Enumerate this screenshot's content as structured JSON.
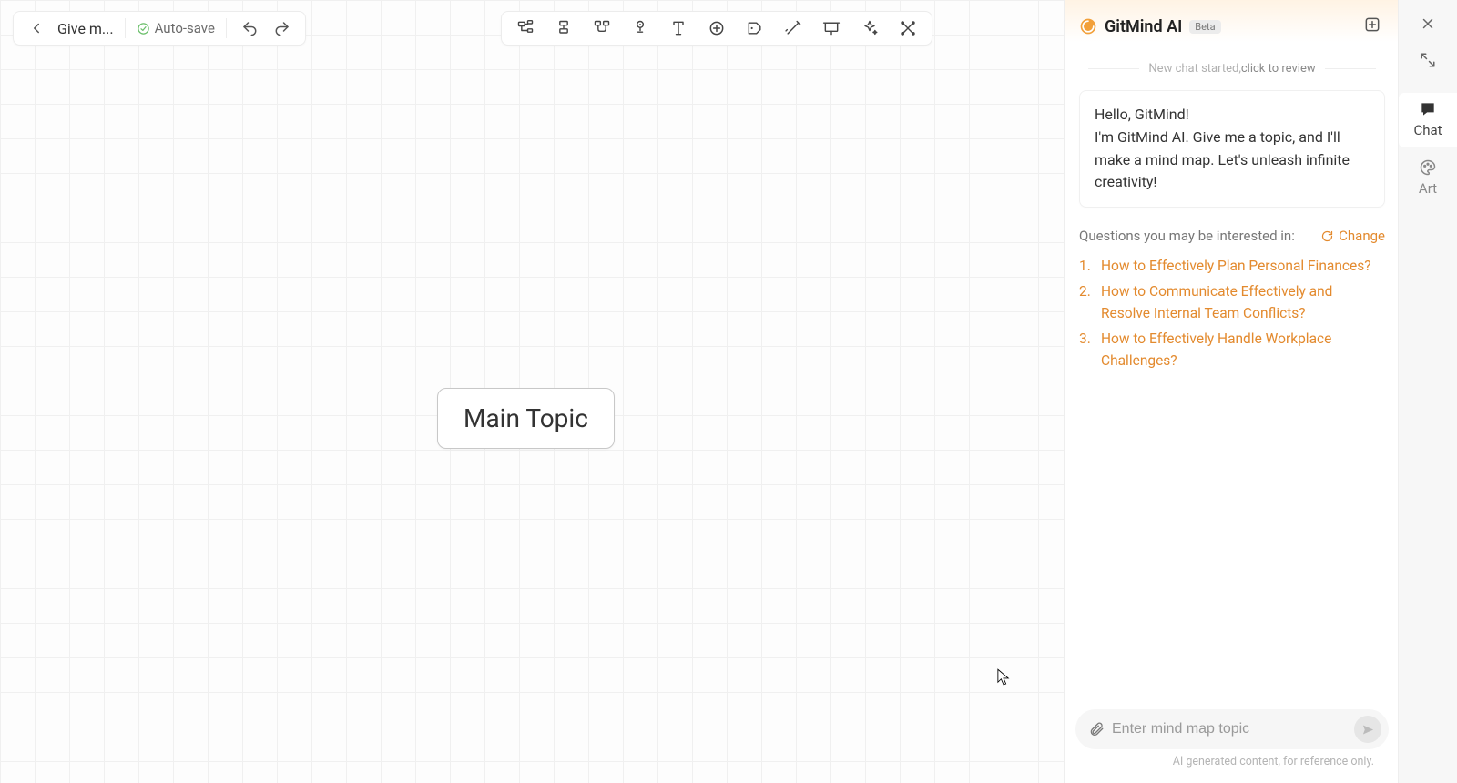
{
  "header": {
    "title": "Give m...",
    "auto_save": "Auto-save"
  },
  "canvas": {
    "main_topic": "Main Topic"
  },
  "ai": {
    "title": "GitMind AI",
    "badge": "Beta",
    "new_chat_prefix": "New chat started, ",
    "review_link": "click to review",
    "greeting": "Hello, GitMind!",
    "intro": "I'm GitMind AI. Give me a topic, and I'll make a mind map. Let's unleash infinite creativity!",
    "subhead": "Questions you may be interested in:",
    "change_label": "Change",
    "suggestions": [
      "How to Effectively Plan Personal Finances?",
      "How to Communicate Effectively and Resolve Internal Team Conflicts?",
      "How to Effectively Handle Workplace Challenges?"
    ],
    "input_placeholder": "Enter mind map topic",
    "footer_note": "AI generated content, for reference only."
  },
  "rail": {
    "chat": "Chat",
    "art": "Art"
  }
}
